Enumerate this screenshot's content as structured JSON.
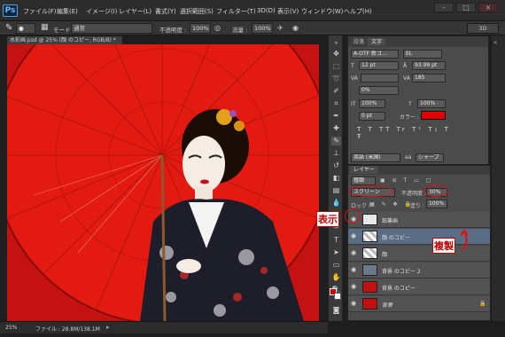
{
  "menubar": {
    "logo": "Ps",
    "items": [
      "ファイル(F)",
      "編集(E)",
      "イメージ(I)",
      "レイヤー(L)",
      "書式(Y)",
      "選択範囲(S)",
      "フィルター(T)",
      "3D(D)",
      "表示(V)",
      "ウィンドウ(W)",
      "ヘルプ(H)"
    ]
  },
  "options": {
    "mode_label": "モード :",
    "mode_value": "通常",
    "opacity_label": "不透明度 :",
    "opacity_value": "100%",
    "flow_label": "流量 :",
    "flow_value": "100%",
    "workspace": "3D"
  },
  "document": {
    "tab_title": "水彩画.psd @ 25% (顔 のコピー, RGB/8) *",
    "zoom": "25%",
    "file_info": "ファイル : 28.8M/138.1M"
  },
  "character_panel": {
    "tabs": [
      "段落",
      "文字"
    ],
    "font_family": "A-OTF 新ゴ...",
    "font_style": "EL",
    "font_size": "12 pt",
    "leading": "93.99 pt",
    "tracking": "185",
    "kerning": "0%",
    "vscale": "100%",
    "hscale": "100%",
    "baseline": "0 pt",
    "color_label": "カラー :",
    "language": "英語 (米国)",
    "antialias": "シャープ",
    "accent_color": "#e00000"
  },
  "layers_panel": {
    "title": "レイヤー",
    "filter_kind": "種類",
    "blend_mode": "スクリーン",
    "opacity_label": "不透明度 :",
    "opacity_value": "30%",
    "lock_label": "ロック :",
    "fill_label": "塗り :",
    "fill_value": "100%",
    "layers": [
      {
        "name": "鉛筆画",
        "selected": false
      },
      {
        "name": "顔 のコピー",
        "selected": true
      },
      {
        "name": "顔",
        "selected": false
      },
      {
        "name": "背景 のコピー 2",
        "selected": false
      },
      {
        "name": "背景 のコピー",
        "selected": false
      },
      {
        "name": "背景",
        "selected": false
      }
    ]
  },
  "annotations": {
    "show_label": "表示",
    "duplicate_label": "複製"
  },
  "colors": {
    "foreground": "#d00000",
    "background": "#ffffff",
    "callout": "#e01010"
  }
}
